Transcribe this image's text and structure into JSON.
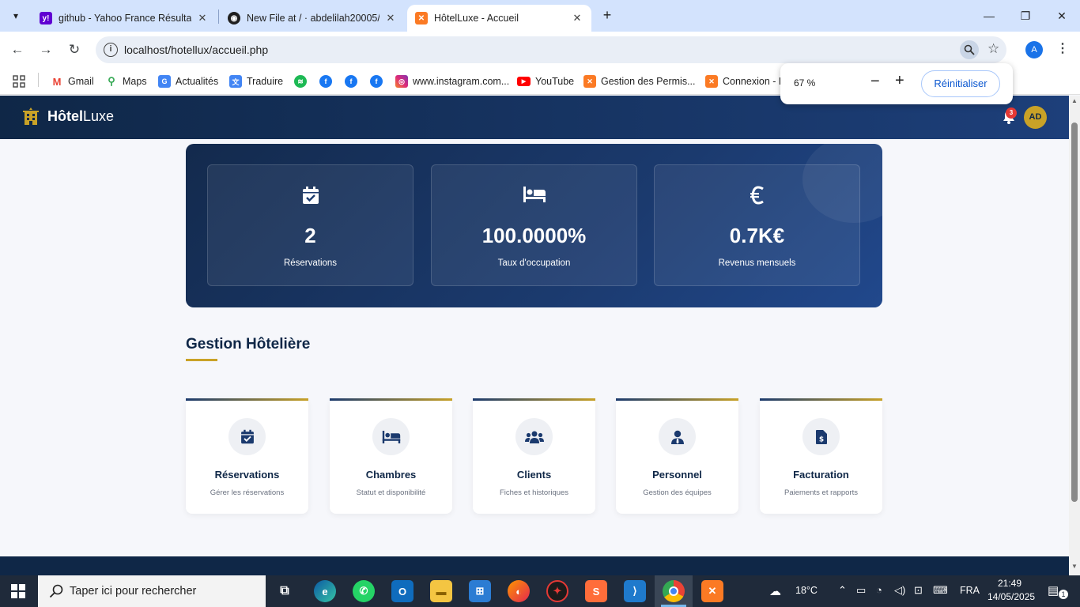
{
  "browser": {
    "tabs": [
      {
        "title": "github - Yahoo France Résultats",
        "favicon": "yahoo-icon"
      },
      {
        "title": "New File at / · abdelilah20005/a",
        "favicon": "github-icon"
      },
      {
        "title": "HôtelLuxe - Accueil",
        "favicon": "xampp-icon",
        "active": true
      }
    ],
    "url": "localhost/hotellux/accueil.php",
    "profile_initial": "A",
    "bookmarks": [
      {
        "label": "Gmail",
        "icon": "gmail-icon"
      },
      {
        "label": "Maps",
        "icon": "maps-icon"
      },
      {
        "label": "Actualités",
        "icon": "news-icon"
      },
      {
        "label": "Traduire",
        "icon": "translate-icon"
      },
      {
        "label": "",
        "icon": "spotify-icon"
      },
      {
        "label": "",
        "icon": "facebook-icon"
      },
      {
        "label": "",
        "icon": "facebook-icon"
      },
      {
        "label": "",
        "icon": "facebook-icon"
      },
      {
        "label": "www.instagram.com...",
        "icon": "instagram-icon"
      },
      {
        "label": "YouTube",
        "icon": "youtube-icon"
      },
      {
        "label": "Gestion des Permis...",
        "icon": "xampp-icon"
      },
      {
        "label": "Connexion - H",
        "icon": "xampp-icon"
      }
    ],
    "zoom_popup": {
      "value": "67 %",
      "minus": "−",
      "plus": "+",
      "reset_label": "Réinitialiser"
    }
  },
  "site": {
    "brand_bold": "Hôtel",
    "brand_light": "Luxe",
    "notification_count": "3",
    "user_initials": "AD",
    "stats": [
      {
        "icon": "calendar-check-icon",
        "value": "2",
        "label": "Réservations"
      },
      {
        "icon": "bed-icon",
        "value": "100.0000%",
        "label": "Taux d'occupation"
      },
      {
        "icon": "euro-icon",
        "value": "0.7K€",
        "label": "Revenus mensuels"
      }
    ],
    "section_title": "Gestion Hôtelière",
    "modules": [
      {
        "icon": "calendar-check-icon",
        "title": "Réservations",
        "subtitle": "Gérer les réservations"
      },
      {
        "icon": "bed-icon",
        "title": "Chambres",
        "subtitle": "Statut et disponibilité"
      },
      {
        "icon": "users-icon",
        "title": "Clients",
        "subtitle": "Fiches et historiques"
      },
      {
        "icon": "user-tie-icon",
        "title": "Personnel",
        "subtitle": "Gestion des équipes"
      },
      {
        "icon": "invoice-icon",
        "title": "Facturation",
        "subtitle": "Paiements et rapports"
      }
    ],
    "colors": {
      "navy": "#0f2747",
      "gold": "#c9a227"
    }
  },
  "taskbar": {
    "search_placeholder": "Taper ici pour rechercher",
    "weather": "18°C",
    "language": "FRA",
    "time": "21:49",
    "date": "14/05/2025",
    "notifications": "1"
  }
}
